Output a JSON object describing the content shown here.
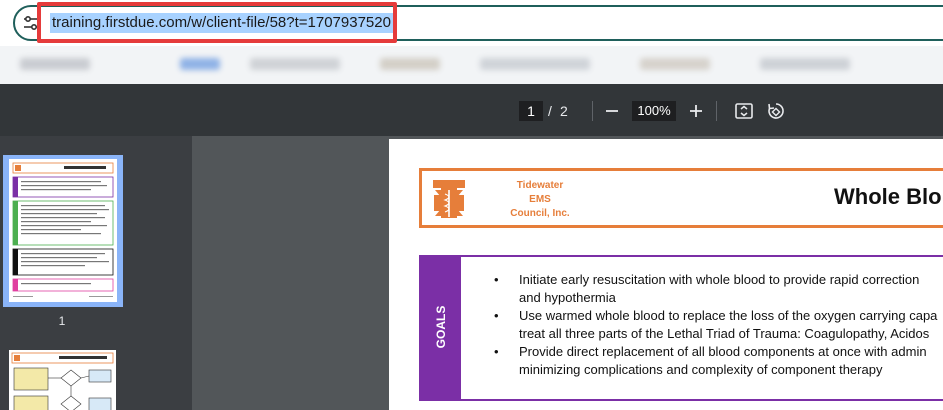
{
  "browser": {
    "url": "training.firstdue.com/w/client-file/58?t=1707937520"
  },
  "pdf_viewer": {
    "current_page": "1",
    "page_separator": "/",
    "total_pages": "2",
    "zoom": "100%",
    "zoom_out_icon": "minus-icon",
    "zoom_in_icon": "plus-icon",
    "fit_icon": "fit-page-icon",
    "rotate_icon": "rotate-icon"
  },
  "sidebar": {
    "thumbnails": [
      {
        "label": "1",
        "selected": true
      },
      {
        "label": "",
        "selected": false
      }
    ]
  },
  "document": {
    "org_name_line1": "Tidewater",
    "org_name_line2": "EMS",
    "org_name_line3": "Council, Inc.",
    "title_partial": "Whole Blo",
    "goals_label": "GOALS",
    "goals": [
      "Initiate early resuscitation with whole blood to provide rapid correction",
      "and hypothermia",
      "Use warmed whole blood to replace the loss of the oxygen carrying capa",
      "treat all three parts of the Lethal Triad of Trauma: Coagulopathy, Acidos",
      "Provide direct replacement of all blood components at once with admin",
      "minimizing complications and complexity of component therapy"
    ],
    "colors": {
      "accent_orange": "#e67e3a",
      "accent_purple": "#7b2fa6"
    }
  }
}
